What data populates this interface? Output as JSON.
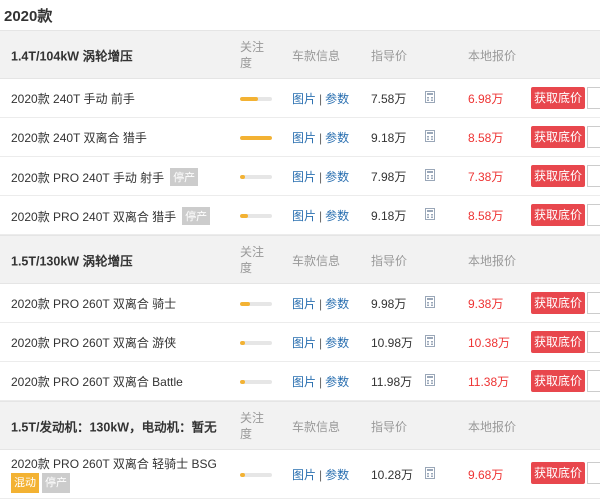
{
  "year_title": "2020款",
  "headers": {
    "follow": "关注度",
    "info": "车款信息",
    "guide": "指导价",
    "local": "本地报价"
  },
  "links": {
    "pics": "图片",
    "sep": "|",
    "params": "参数"
  },
  "button_label": "获取底价",
  "groups": [
    {
      "name": "1.4T/104kW 涡轮增压",
      "rows": [
        {
          "name": "2020款 240T 手动 前手",
          "tag": "",
          "follow_level": 0.55,
          "guide_price": "7.58万",
          "local_price": "6.98万"
        },
        {
          "name": "2020款 240T 双离合 猎手",
          "tag": "",
          "follow_level": 1.0,
          "guide_price": "9.18万",
          "local_price": "8.58万"
        },
        {
          "name": "2020款 PRO 240T 手动 射手",
          "tag": "停产",
          "follow_level": 0.15,
          "guide_price": "7.98万",
          "local_price": "7.38万"
        },
        {
          "name": "2020款 PRO 240T 双离合 猎手",
          "tag": "停产",
          "follow_level": 0.25,
          "guide_price": "9.18万",
          "local_price": "8.58万"
        }
      ]
    },
    {
      "name": "1.5T/130kW 涡轮增压",
      "rows": [
        {
          "name": "2020款 PRO 260T 双离合 骑士",
          "tag": "",
          "follow_level": 0.3,
          "guide_price": "9.98万",
          "local_price": "9.38万"
        },
        {
          "name": "2020款 PRO 260T 双离合 游侠",
          "tag": "",
          "follow_level": 0.15,
          "guide_price": "10.98万",
          "local_price": "10.38万"
        },
        {
          "name": "2020款 PRO 260T 双离合 Battle",
          "tag": "",
          "follow_level": 0.15,
          "guide_price": "11.98万",
          "local_price": "11.38万"
        }
      ]
    },
    {
      "name": "1.5T/发动机：130kW，电动机：暂无",
      "rows": [
        {
          "name": "2020款 PRO 260T 双离合 轻骑士 BSG",
          "tags": [
            "混动",
            "停产"
          ],
          "follow_level": 0.15,
          "guide_price": "10.28万",
          "local_price": "9.68万"
        }
      ]
    }
  ]
}
